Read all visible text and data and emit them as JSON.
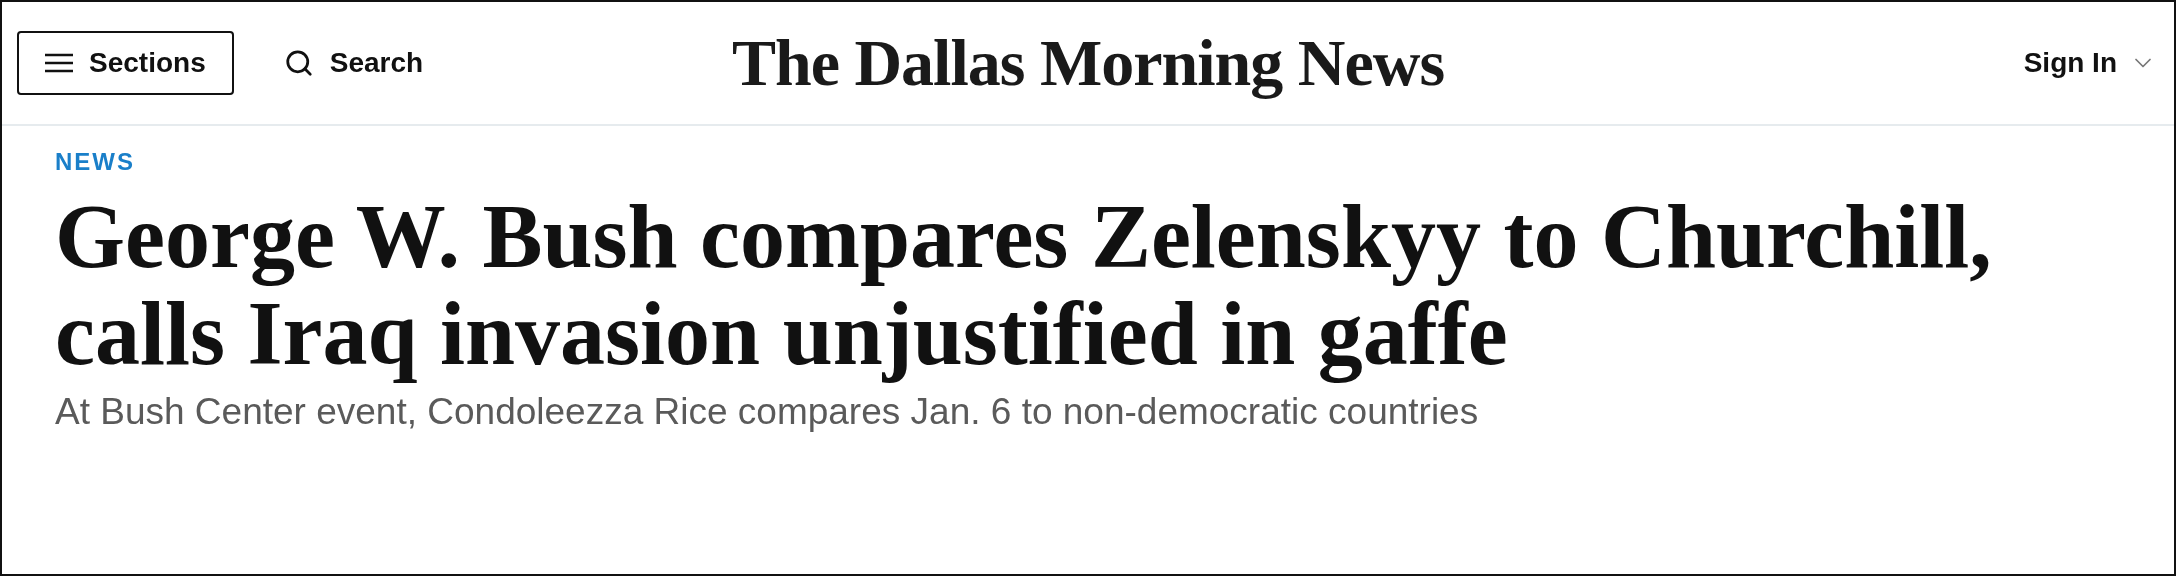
{
  "header": {
    "sections_button": "Sections",
    "search_link": "Search",
    "logo": "The Dallas Morning News",
    "sign_in": "Sign In"
  },
  "article": {
    "section": "NEWS",
    "headline": "George W. Bush compares Zelenskyy to Churchill, calls Iraq invasion unjustified in gaffe",
    "subheadline": "At Bush Center event, Condoleezza Rice compares Jan. 6 to non-democratic countries"
  }
}
